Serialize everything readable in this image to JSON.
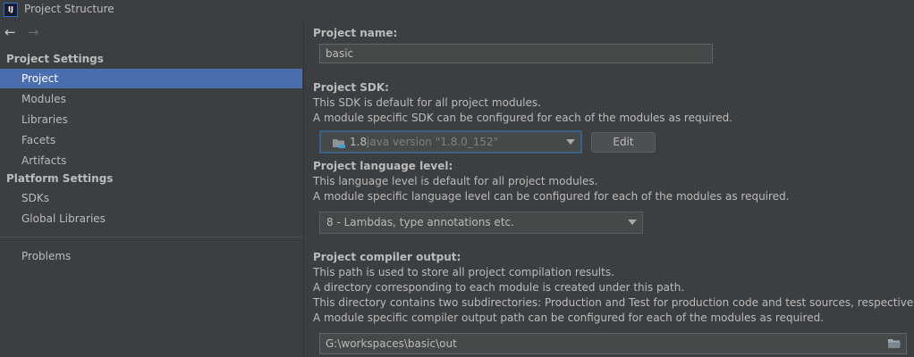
{
  "window": {
    "title": "Project Structure",
    "logo_text": "IJ"
  },
  "nav": {
    "back": "←",
    "forward": "→"
  },
  "sidebar": {
    "project_settings_header": "Project Settings",
    "project_items": [
      {
        "label": "Project"
      },
      {
        "label": "Modules"
      },
      {
        "label": "Libraries"
      },
      {
        "label": "Facets"
      },
      {
        "label": "Artifacts"
      }
    ],
    "platform_settings_header": "Platform Settings",
    "platform_items": [
      {
        "label": "SDKs"
      },
      {
        "label": "Global Libraries"
      }
    ],
    "problems_label": "Problems",
    "selected": "Project"
  },
  "main": {
    "project_name": {
      "label": "Project name:",
      "value": "basic"
    },
    "project_sdk": {
      "label": "Project SDK:",
      "desc1": "This SDK is default for all project modules.",
      "desc2": "A module specific SDK can be configured for each of the modules as required.",
      "selected_version": "1.8",
      "selected_detail": "java version \"1.8.0_152\"",
      "edit_label": "Edit"
    },
    "language_level": {
      "label": "Project language level:",
      "desc1": "This language level is default for all project modules.",
      "desc2": "A module specific language level can be configured for each of the modules as required.",
      "selected": "8 - Lambdas, type annotations etc."
    },
    "compiler_output": {
      "label": "Project compiler output:",
      "desc1": "This path is used to store all project compilation results.",
      "desc2": "A directory corresponding to each module is created under this path.",
      "desc3": "This directory contains two subdirectories: Production and Test for production code and test sources, respectively.",
      "desc4": "A module specific compiler output path can be configured for each of the modules as required.",
      "value": "G:\\workspaces\\basic\\out"
    }
  },
  "colors": {
    "background": "#3c3f41",
    "selection": "#4b6eaf",
    "field": "#45494a",
    "text": "#bbbbbb"
  }
}
